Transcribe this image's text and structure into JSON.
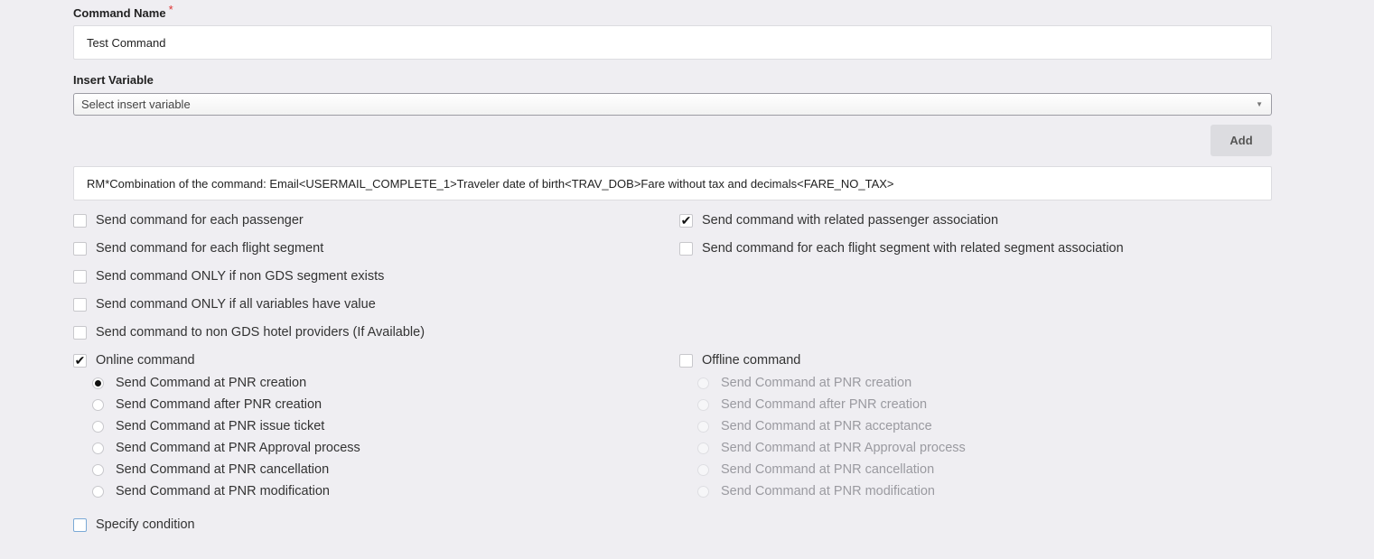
{
  "command_name": {
    "label": "Command Name",
    "required_mark": "*",
    "value": "Test Command"
  },
  "insert_variable": {
    "label": "Insert Variable",
    "selected": "Select insert variable",
    "add_button": "Add"
  },
  "command_text": {
    "value": "RM*Combination of the command: Email<USERMAIL_COMPLETE_1>Traveler date of birth<TRAV_DOB>Fare without tax and decimals<FARE_NO_TAX>"
  },
  "options_left": [
    {
      "label": "Send command for each passenger",
      "checked": false
    },
    {
      "label": "Send command for each flight segment",
      "checked": false
    },
    {
      "label": "Send command ONLY if non GDS segment exists",
      "checked": false
    },
    {
      "label": "Send command ONLY if all variables have value",
      "checked": false
    },
    {
      "label": "Send command to non GDS hotel providers (If Available)",
      "checked": false
    }
  ],
  "options_right": [
    {
      "label": "Send command with related passenger association",
      "checked": true
    },
    {
      "label": "Send command for each flight segment with related segment association",
      "checked": false
    }
  ],
  "online": {
    "label": "Online command",
    "checked": true,
    "radios": [
      {
        "label": "Send Command at PNR creation",
        "selected": true
      },
      {
        "label": "Send Command after PNR creation",
        "selected": false
      },
      {
        "label": "Send Command at PNR issue ticket",
        "selected": false
      },
      {
        "label": "Send Command at PNR Approval process",
        "selected": false
      },
      {
        "label": "Send Command at PNR cancellation",
        "selected": false
      },
      {
        "label": "Send Command at PNR modification",
        "selected": false
      }
    ]
  },
  "offline": {
    "label": "Offline command",
    "checked": false,
    "radios": [
      {
        "label": "Send Command at PNR creation",
        "selected": false
      },
      {
        "label": "Send Command after PNR creation",
        "selected": false
      },
      {
        "label": "Send Command at PNR acceptance",
        "selected": false
      },
      {
        "label": "Send Command at PNR Approval process",
        "selected": false
      },
      {
        "label": "Send Command at PNR cancellation",
        "selected": false
      },
      {
        "label": "Send Command at PNR modification",
        "selected": false
      }
    ]
  },
  "specify_condition": {
    "label": "Specify condition",
    "checked": false
  },
  "icons": {
    "check": "✔",
    "dropdown": "▼"
  }
}
